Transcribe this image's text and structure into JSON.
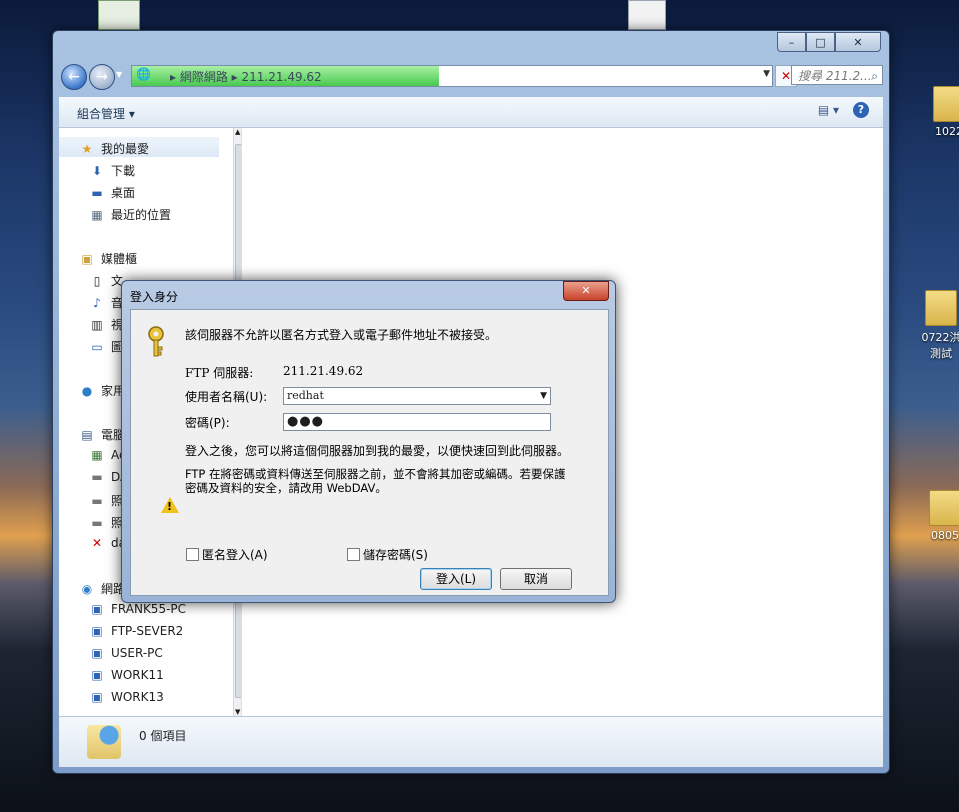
{
  "desktop": {
    "icons": [
      {
        "label": "1022"
      },
      {
        "label": "0722洪"
      },
      {
        "label": "測試"
      },
      {
        "label": "0805"
      }
    ]
  },
  "explorer": {
    "address": {
      "segments": [
        "網際網路",
        "211.21.49.62"
      ],
      "load_progress": 0.48
    },
    "search_placeholder": "搜尋 211.2...",
    "toolbar": {
      "organize_label": "組合管理 ▾"
    },
    "nav": {
      "favorites": {
        "label": "我的最愛",
        "items": [
          "下載",
          "桌面",
          "最近的位置"
        ]
      },
      "libraries": {
        "label": "媒體櫃",
        "items": [
          "文",
          "音",
          "視",
          "圖"
        ]
      },
      "homegroup": {
        "label": "家用"
      },
      "computer": {
        "label": "電腦",
        "items": [
          "Ac",
          "DA",
          "照",
          "照",
          "da"
        ]
      },
      "network": {
        "label": "網路",
        "items": [
          "FRANK55-PC",
          "FTP-SEVER2",
          "USER-PC",
          "WORK11",
          "WORK13"
        ]
      }
    },
    "status": {
      "items_text": "0 個項目"
    }
  },
  "dialog": {
    "title": "登入身分",
    "intro": "該伺服器不允許以匿名方式登入或電子郵件地址不被接受。",
    "server_label": "FTP 伺服器:",
    "server_value": "211.21.49.62",
    "username_label": "使用者名稱(U):",
    "username_value": "redhat",
    "password_label": "密碼(P):",
    "password_mask": "●●●",
    "after_login_text": "登入之後，您可以將這個伺服器加到我的最愛，以便快速回到此伺服器。",
    "warning_line1": "FTP 在將密碼或資料傳送至伺服器之前，並不會將其加密或編碼。若要保護",
    "warning_line2": "密碼及資料的安全，請改用 WebDAV。",
    "anonymous_label": "匿名登入(A)",
    "save_password_label": "儲存密碼(S)",
    "login_button": "登入(L)",
    "cancel_button": "取消"
  }
}
